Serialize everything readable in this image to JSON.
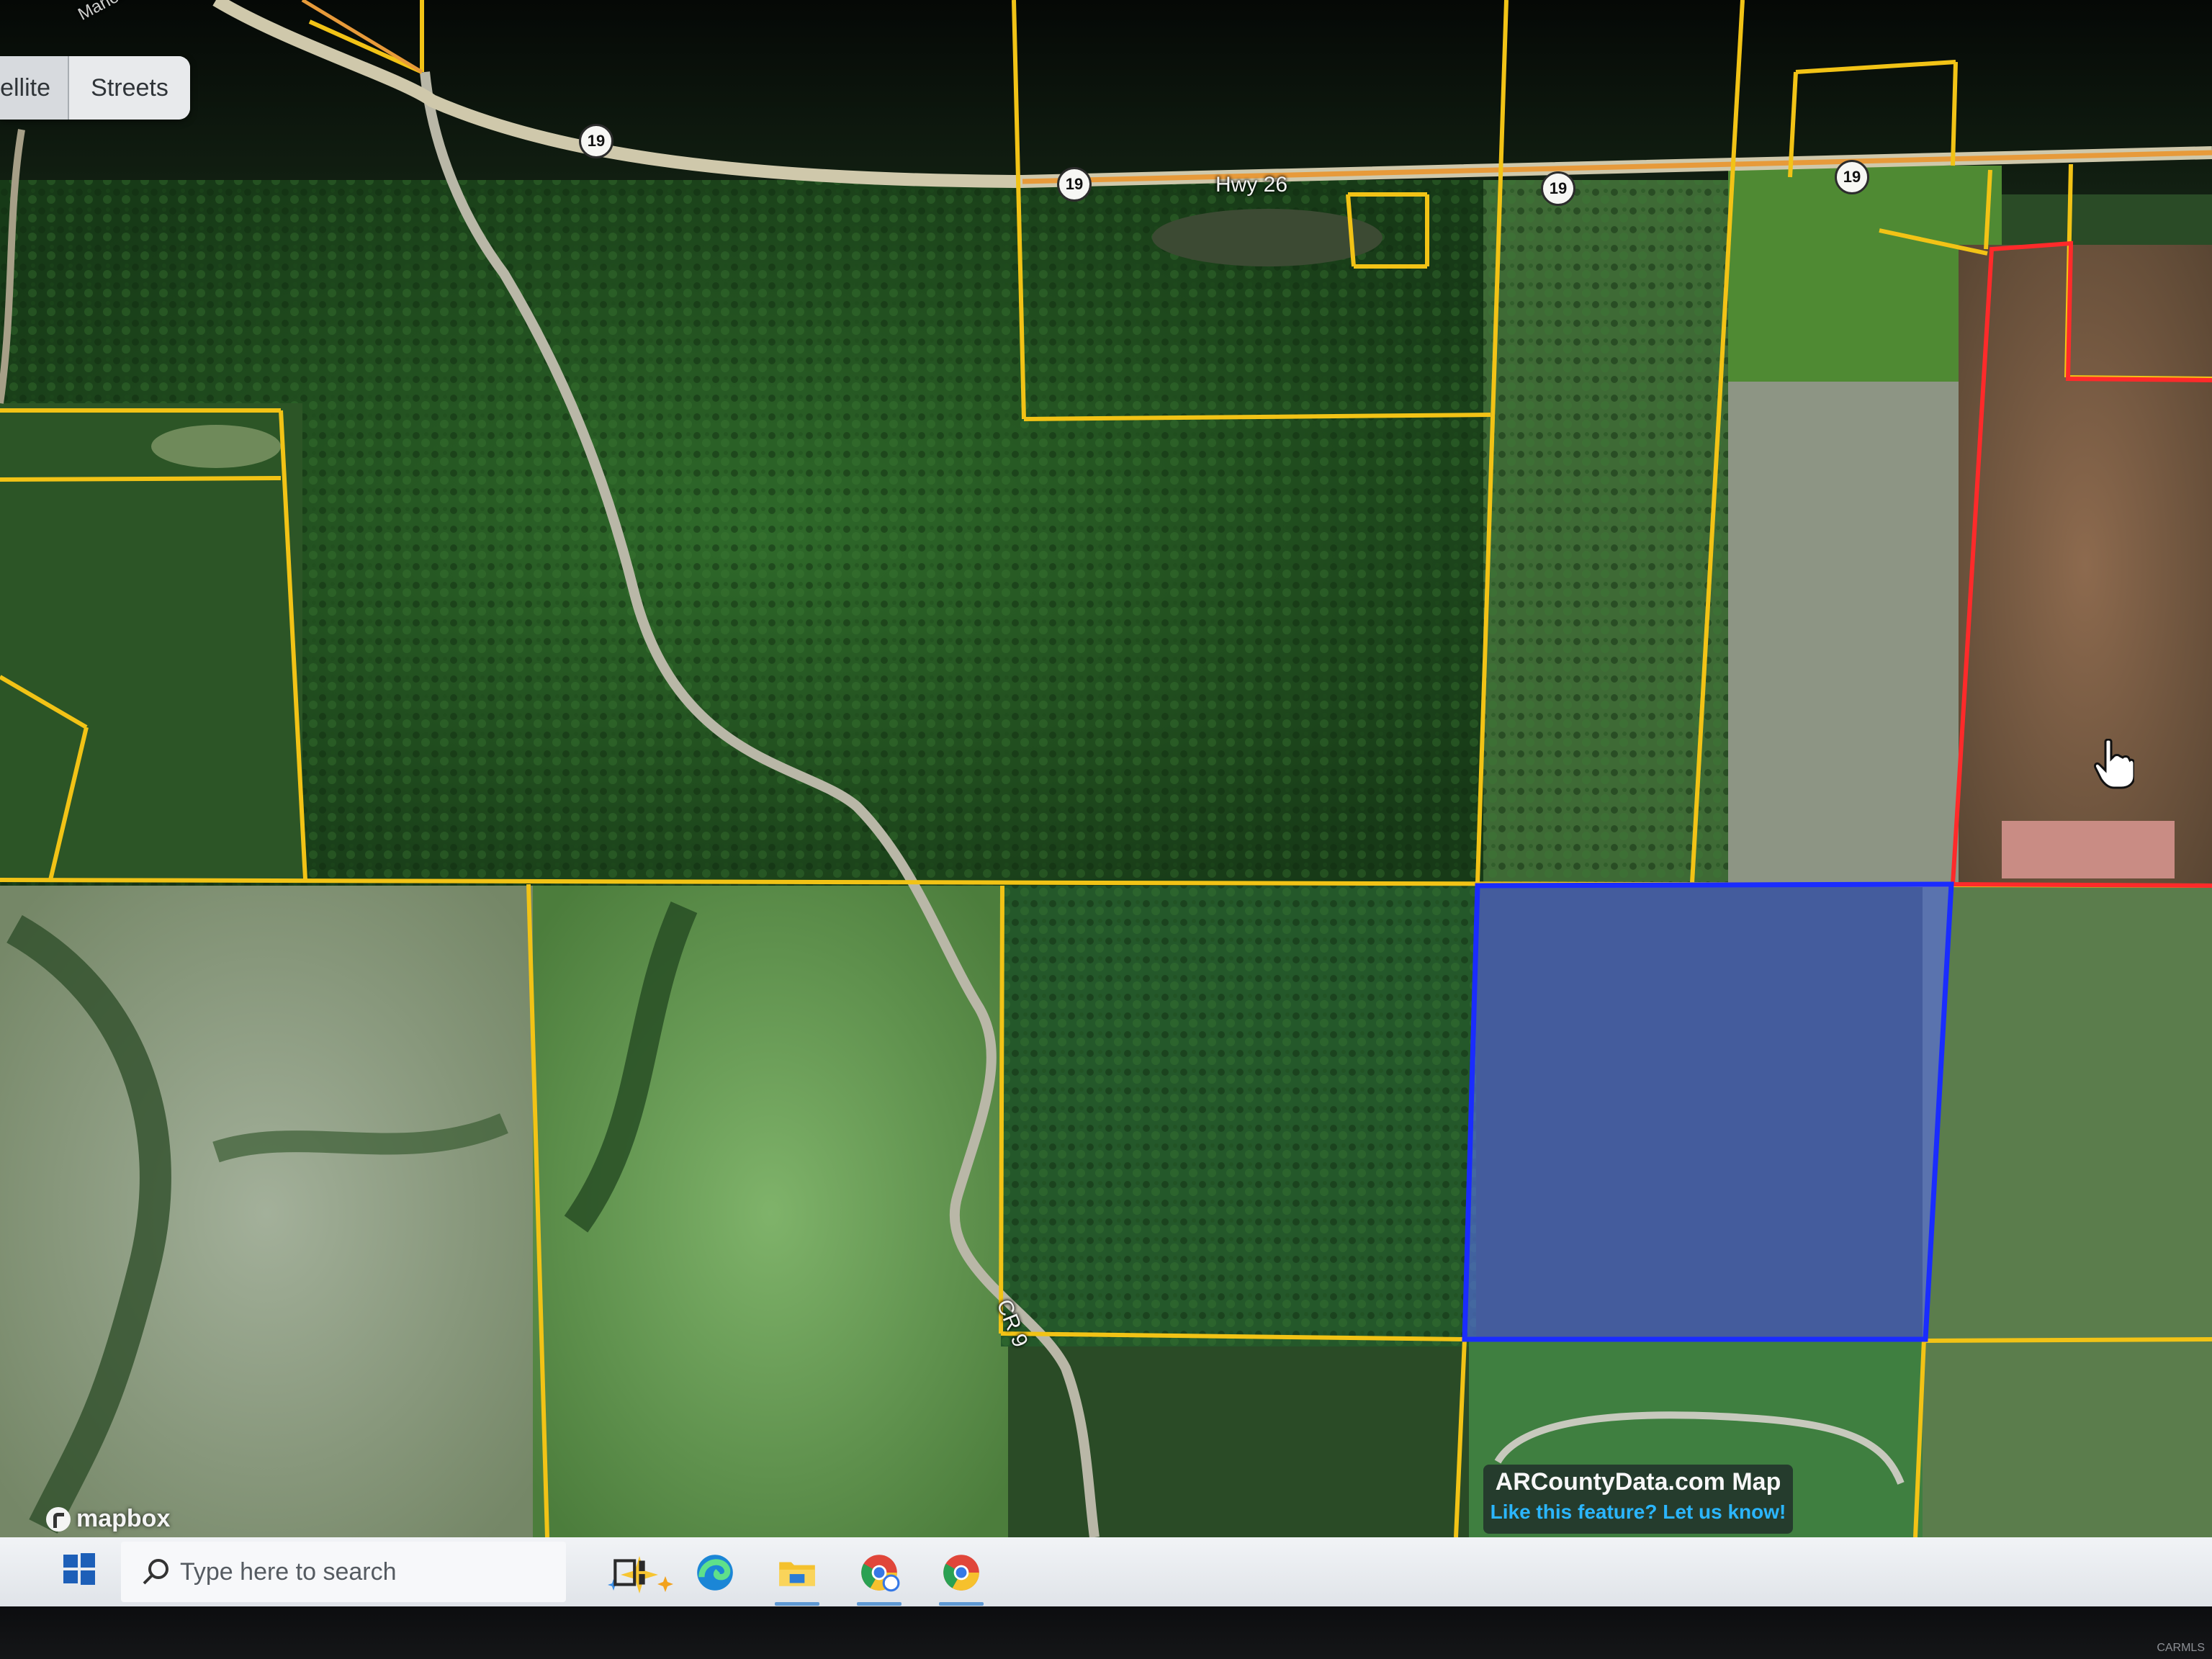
{
  "map": {
    "layer_toggle": {
      "satellite_label": "ellite",
      "streets_label": "Streets"
    },
    "road_labels": {
      "highway_name": "Hwy 26",
      "county_road": "CR 9",
      "upper_left_road": "Marion Riley"
    },
    "route_shields": [
      "19",
      "19",
      "19",
      "19"
    ],
    "attribution": {
      "brand": "mapbox",
      "title": "ARCountyData.com Map",
      "feedback_link": "Like this feature? Let us know!"
    },
    "colors": {
      "parcel_boundary": "#f2c316",
      "selected_parcel_border": "#1a2cff",
      "selected_parcel_fill": "#5a6cff",
      "adjacent_parcel_border": "#ff2a2a",
      "highway_line": "#e79a3a"
    },
    "icons": [
      "hand-pointer-icon",
      "mapbox-logo-icon"
    ]
  },
  "taskbar": {
    "search_placeholder": "Type here to search",
    "icons": [
      "windows-start-icon",
      "search-icon",
      "copilot-sparkle-icon",
      "task-view-icon",
      "edge-browser-icon",
      "file-explorer-icon",
      "chrome-profile-icon",
      "chrome-icon"
    ]
  },
  "watermark": {
    "text": "CARMLS"
  }
}
